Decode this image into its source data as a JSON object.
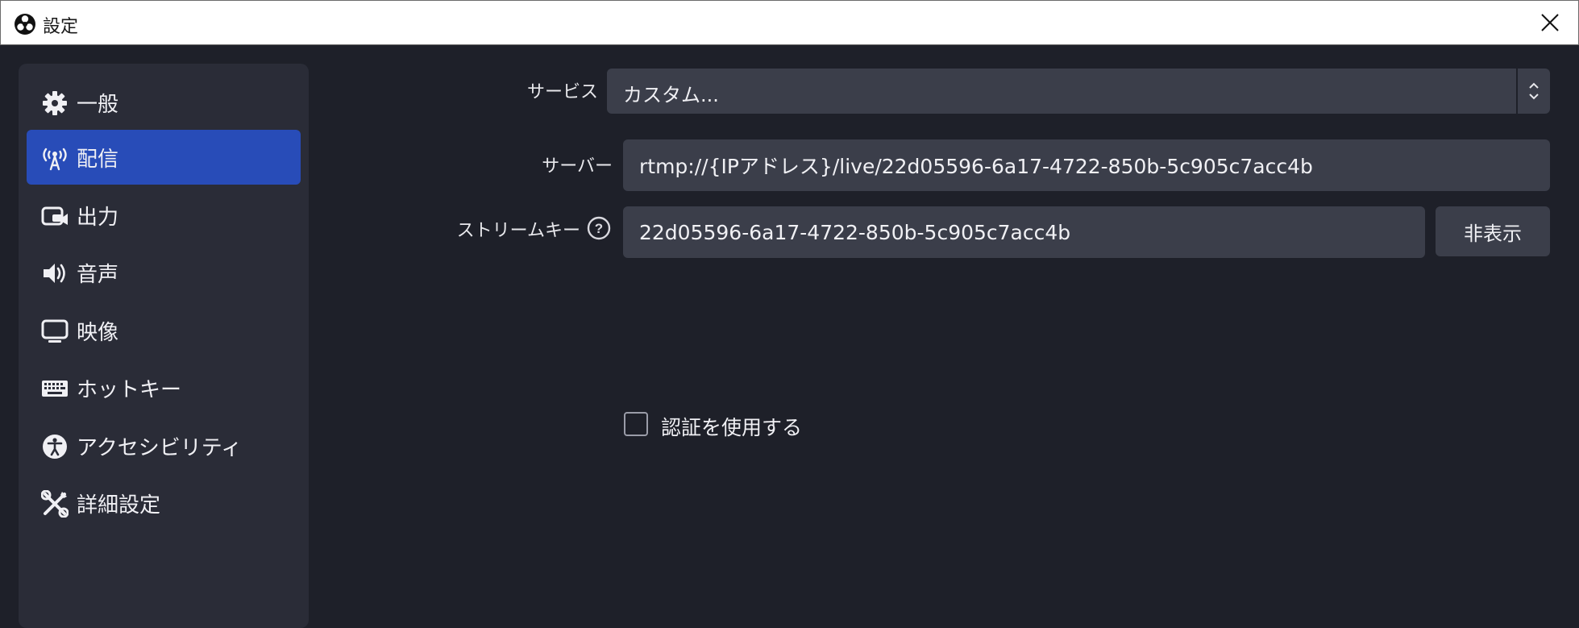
{
  "window": {
    "title": "設定"
  },
  "sidebar": {
    "items": [
      {
        "label": "一般",
        "icon": "gear-icon"
      },
      {
        "label": "配信",
        "icon": "antenna-icon",
        "active": true
      },
      {
        "label": "出力",
        "icon": "output-camera-icon"
      },
      {
        "label": "音声",
        "icon": "speaker-icon"
      },
      {
        "label": "映像",
        "icon": "monitor-icon"
      },
      {
        "label": "ホットキー",
        "icon": "keyboard-icon"
      },
      {
        "label": "アクセシビリティ",
        "icon": "accessibility-icon"
      },
      {
        "label": "詳細設定",
        "icon": "tools-icon"
      }
    ]
  },
  "form": {
    "service_label": "サービス",
    "service_value": "カスタム...",
    "server_label": "サーバー",
    "server_value": "rtmp://{IPアドレス}/live/22d05596-6a17-4722-850b-5c905c7acc4b",
    "stream_key_label": "ストリームキー",
    "stream_key_value": "22d05596-6a17-4722-850b-5c905c7acc4b",
    "hide_button": "非表示",
    "auth_label": "認証を使用する",
    "auth_checked": false
  },
  "colors": {
    "background": "#1e2029",
    "sidebar": "#2a2c37",
    "active": "#284cb8",
    "field": "#3b3e4a"
  }
}
